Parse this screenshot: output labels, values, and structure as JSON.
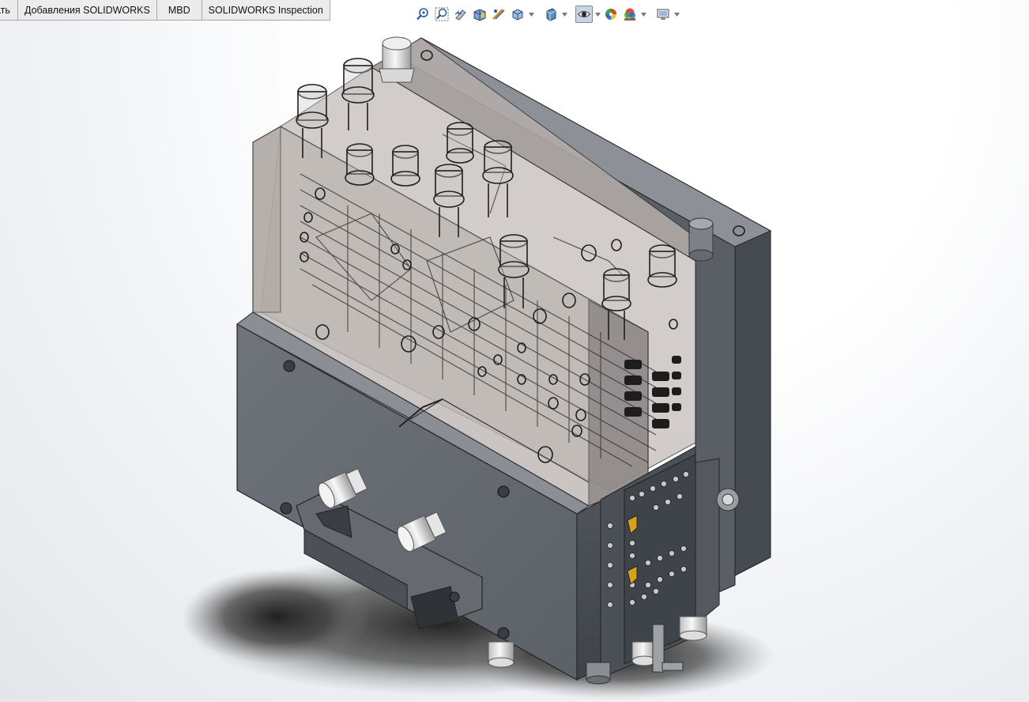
{
  "command_manager": {
    "tabs": [
      {
        "label": "ать",
        "truncated": true
      },
      {
        "label": "Добавления SOLIDWORKS"
      },
      {
        "label": "MBD"
      },
      {
        "label": "SOLIDWORKS Inspection"
      }
    ]
  },
  "heads_up_toolbar": {
    "buttons": [
      {
        "icon": "zoom-to-fit-icon"
      },
      {
        "icon": "zoom-to-area-icon"
      },
      {
        "icon": "previous-view-icon"
      },
      {
        "icon": "section-view-icon"
      },
      {
        "icon": "dynamic-annotation-views-icon"
      },
      {
        "icon": "view-orientation-icon",
        "dropdown": true
      },
      {
        "icon": "display-style-icon",
        "dropdown": true
      },
      {
        "icon": "hide-show-items-icon",
        "dropdown": true,
        "pressed": true
      },
      {
        "icon": "edit-appearance-icon"
      },
      {
        "icon": "apply-scene-icon",
        "dropdown": true
      },
      {
        "icon": "view-settings-icon",
        "dropdown": true
      }
    ]
  },
  "graphics_area": {
    "model": "injection-mold-assembly",
    "colors": {
      "plate_dark": "#4c5158",
      "plate_light": "#8a8e94",
      "transparent_plate": "#c9c3c0",
      "accent_yellow": "#d6a219",
      "background": "#ffffff"
    }
  }
}
